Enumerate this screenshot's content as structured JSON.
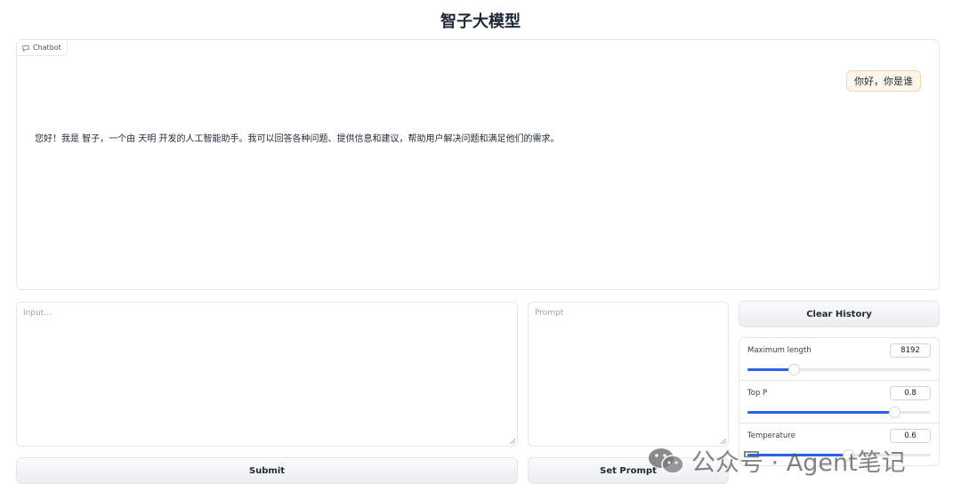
{
  "page": {
    "title": "智子大模型"
  },
  "chatbot": {
    "label": "Chatbot",
    "messages": [
      {
        "role": "user",
        "text": "你好，你是谁"
      },
      {
        "role": "bot",
        "text": "您好！我是 智子，一个由 天明 开发的人工智能助手。我可以回答各种问题、提供信息和建议，帮助用户解决问题和满足他们的需求。"
      }
    ]
  },
  "input": {
    "placeholder": "Input..."
  },
  "prompt": {
    "placeholder": "Prompt"
  },
  "buttons": {
    "clear_history": "Clear History",
    "submit": "Submit",
    "set_prompt": "Set Prompt"
  },
  "params": {
    "max_length": {
      "label": "Maximum length",
      "value": "8192",
      "fraction": 0.25
    },
    "top_p": {
      "label": "Top P",
      "value": "0.8",
      "fraction": 0.8
    },
    "temperature": {
      "label": "Temperature",
      "value": "0.6",
      "fraction": 0.55
    }
  },
  "watermark": {
    "text": "公众号 · Agent笔记"
  },
  "colors": {
    "accent": "#2563eb",
    "user_bubble_bg": "#fff6ea",
    "user_bubble_border": "#f5d5ae"
  }
}
